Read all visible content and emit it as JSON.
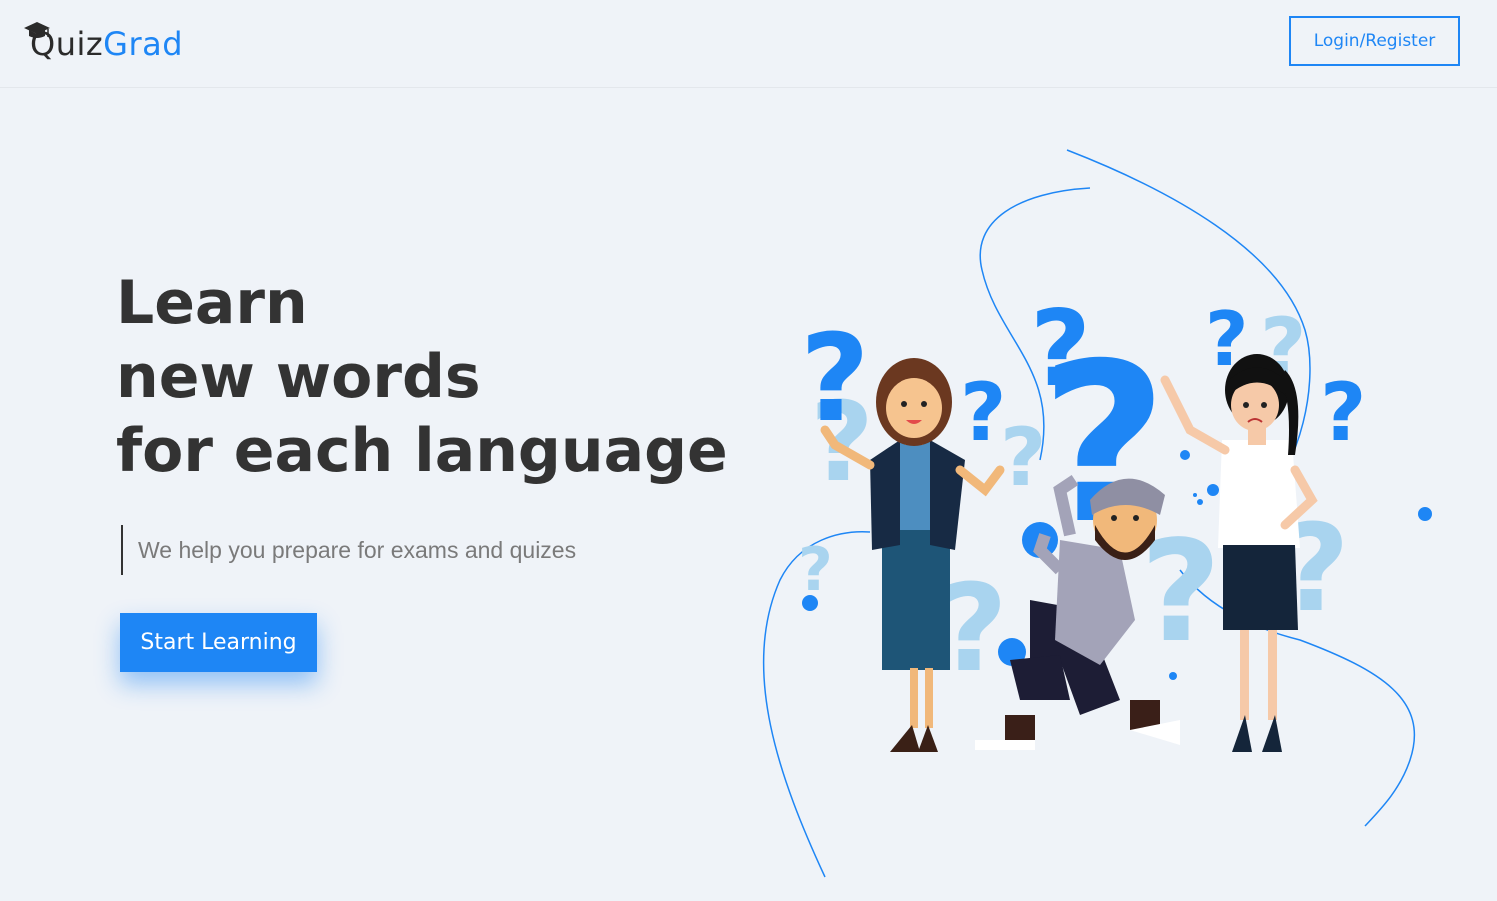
{
  "header": {
    "logo": {
      "part1": "Quiz",
      "part2": "Grad",
      "icon": "graduation-cap-icon"
    },
    "login_label": "Login/Register"
  },
  "hero": {
    "headline": [
      "Learn",
      "new words",
      "for each language"
    ],
    "tagline": "We help you prepare for exams and quizes",
    "cta_label": "Start Learning"
  },
  "illustration": {
    "subject": "people-with-question-marks",
    "glyph": "?"
  },
  "colors": {
    "accent": "#1e86f5",
    "background": "#eff3f8",
    "text_dark": "#333333",
    "text_muted": "#7a7a7a",
    "light_blue": "#a9d4ef"
  }
}
